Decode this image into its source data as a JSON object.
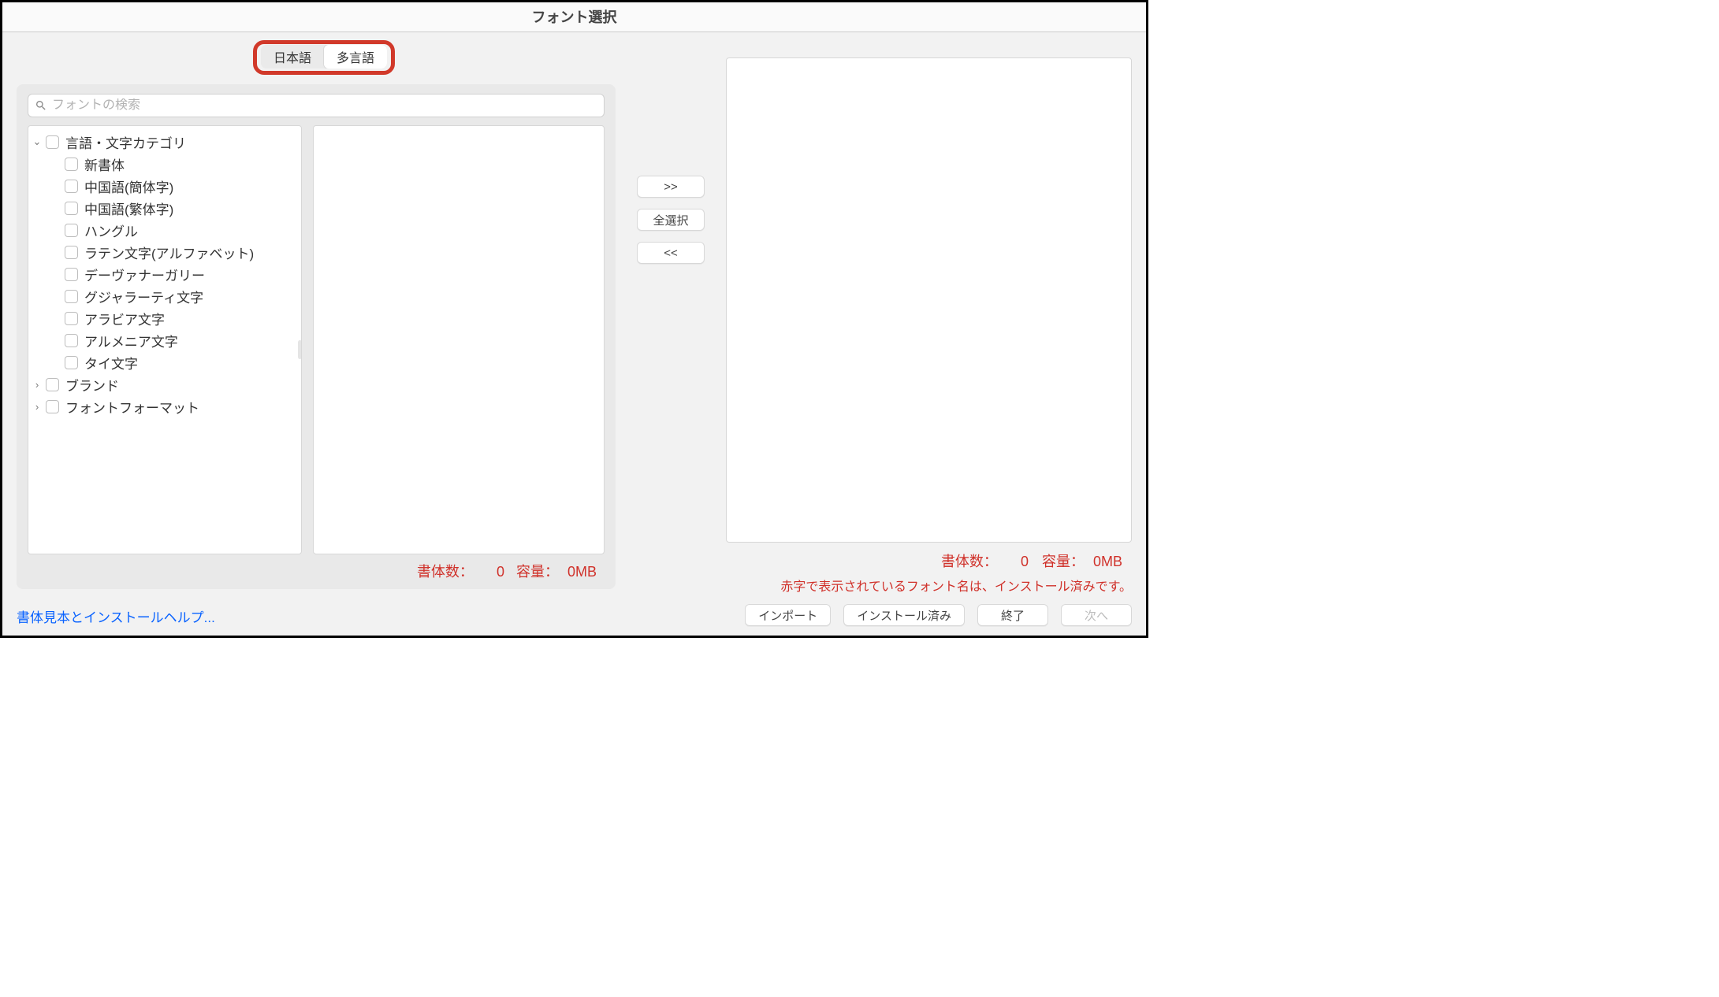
{
  "window": {
    "title": "フォント選択"
  },
  "tabs": {
    "japanese": "日本語",
    "multilingual": "多言語",
    "active": "multilingual"
  },
  "search": {
    "placeholder": "フォントの検索"
  },
  "tree": {
    "top": "言語・文字カテゴリ",
    "items": [
      "新書体",
      "中国語(簡体字)",
      "中国語(繁体字)",
      "ハングル",
      "ラテン文字(アルファベット)",
      "デーヴァナーガリー",
      "グジャラーティ文字",
      "アラビア文字",
      "アルメニア文字",
      "タイ文字"
    ],
    "brand": "ブランド",
    "format": "フォントフォーマット"
  },
  "midButtons": {
    "addAll": ">>",
    "selectAll": "全選択",
    "removeAll": "<<"
  },
  "leftFooter": {
    "countLabel": "書体数：",
    "countValue": "0",
    "sizeLabel": "容量：",
    "sizeValue": "0MB"
  },
  "rightFooter": {
    "countLabel": "書体数：",
    "countValue": "0",
    "sizeLabel": "容量：",
    "sizeValue": "0MB"
  },
  "note": "赤字で表示されているフォント名は、インストール済みです。",
  "help": "書体見本とインストールヘルプ...",
  "actions": {
    "import": "インポート",
    "installed": "インストール済み",
    "quit": "終了",
    "next": "次へ"
  }
}
